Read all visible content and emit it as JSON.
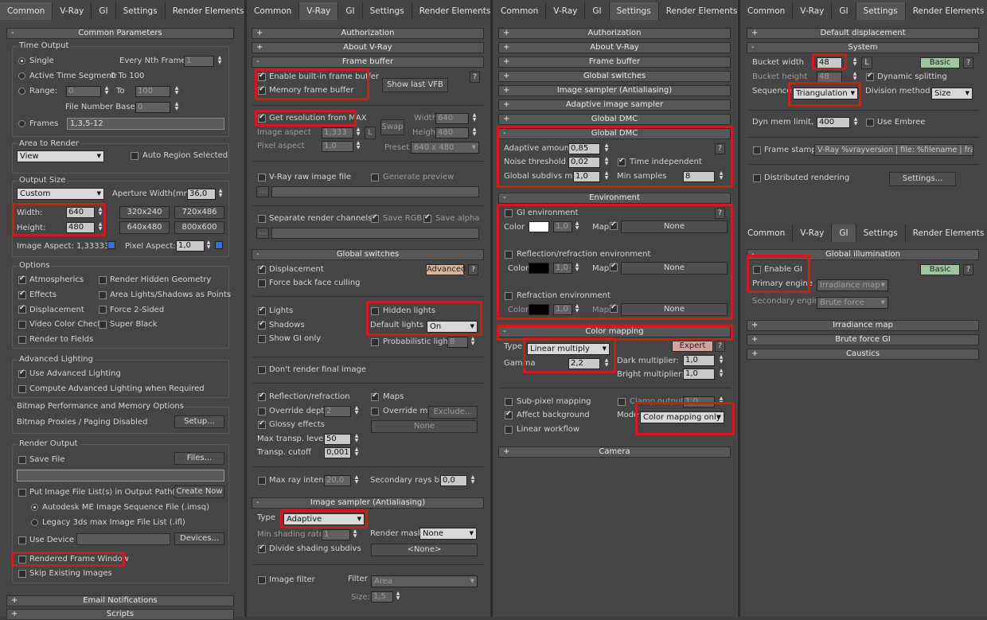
{
  "tabs": [
    "Common",
    "V-Ray",
    "GI",
    "Settings",
    "Render Elements"
  ],
  "common": {
    "rollout_title": "Common Parameters",
    "time_output": {
      "title": "Time Output",
      "single": "Single",
      "every_nth": "Every Nth Frame:",
      "every_nth_val": "1",
      "active_segment": "Active Time Segment:",
      "active_range": "0 To 100",
      "range": "Range:",
      "range_from": "0",
      "to": "To",
      "range_to": "100",
      "file_number_base": "File Number Base:",
      "fnb_val": "0",
      "frames": "Frames",
      "frames_val": "1,3,5-12"
    },
    "area": {
      "title": "Area to Render",
      "value": "View",
      "auto_region": "Auto Region Selected"
    },
    "output_size": {
      "title": "Output Size",
      "preset": "Custom",
      "aperture": "Aperture Width(mm):",
      "aperture_val": "36,0",
      "width": "Width:",
      "width_val": "640",
      "height": "Height:",
      "height_val": "480",
      "presets": [
        "320x240",
        "720x486",
        "640x480",
        "800x600"
      ],
      "image_aspect": "Image Aspect: 1,33333",
      "pixel_aspect": "Pixel Aspect:",
      "pixel_aspect_val": "1,0"
    },
    "options": {
      "title": "Options",
      "atmospherics": "Atmospherics",
      "render_hidden": "Render Hidden Geometry",
      "effects": "Effects",
      "area_lights": "Area Lights/Shadows as Points",
      "displacement": "Displacement",
      "force_2sided": "Force 2-Sided",
      "video_color": "Video Color Check",
      "super_black": "Super Black",
      "render_fields": "Render to Fields"
    },
    "adv_lighting": {
      "title": "Advanced Lighting",
      "use": "Use Advanced Lighting",
      "compute": "Compute Advanced Lighting when Required"
    },
    "bitmap": {
      "title": "Bitmap Performance and Memory Options",
      "proxies": "Bitmap Proxies / Paging Disabled",
      "setup": "Setup..."
    },
    "render_output": {
      "title": "Render Output",
      "save_file": "Save File",
      "files": "Files...",
      "put_image": "Put Image File List(s) in Output Path(s)",
      "create_now": "Create Now",
      "autodesk": "Autodesk ME Image Sequence File (.imsq)",
      "legacy": "Legacy 3ds max Image File List (.ifl)",
      "use_device": "Use Device",
      "devices": "Devices...",
      "rendered_frame": "Rendered Frame Window",
      "skip_existing": "Skip Existing Images"
    },
    "email": "Email Notifications",
    "scripts": "Scripts"
  },
  "vray": {
    "authorization": "Authorization",
    "about": "About V-Ray",
    "frame_buffer": "Frame buffer",
    "enable_vfb": "Enable built-in frame buffer",
    "memory_fb": "Memory frame buffer",
    "show_last_vfb": "Show last VFB",
    "get_res": "Get resolution from MAX",
    "width": "Width",
    "width_val": "640",
    "height": "Height",
    "height_val": "480",
    "swap": "Swap",
    "image_aspect": "Image aspect",
    "image_aspect_val": "1,333",
    "L": "L",
    "pixel_aspect": "Pixel aspect",
    "pixel_aspect_val": "1,0",
    "preset": "Preset",
    "preset_val": "640 x 480",
    "raw_image": "V-Ray raw image file",
    "gen_preview": "Generate preview",
    "separate": "Separate render channels",
    "save_rgb": "Save RGB",
    "save_alpha": "Save alpha",
    "ellipsis": "...",
    "global_switches": "Global switches",
    "displacement": "Displacement",
    "advanced": "Advanced",
    "force_back": "Force back face culling",
    "lights": "Lights",
    "hidden_lights": "Hidden lights",
    "shadows": "Shadows",
    "default_lights": "Default lights",
    "default_lights_val": "On",
    "show_gi_only": "Show GI only",
    "probabilistic": "Probabilistic lights",
    "probabilistic_val": "8",
    "dont_render": "Don't render final image",
    "reflection": "Reflection/refraction",
    "maps": "Maps",
    "override_depth": "Override depth",
    "override_depth_val": "2",
    "override_mtl": "Override mtl",
    "exclude": "Exclude...",
    "glossy": "Glossy effects",
    "none": "None",
    "max_transp": "Max transp. levels",
    "max_transp_val": "50",
    "transp_cutoff": "Transp. cutoff",
    "transp_cutoff_val": "0,001",
    "max_ray": "Max ray intens",
    "max_ray_val": "20,0",
    "secondary_bias": "Secondary rays bias",
    "secondary_bias_val": "0,0",
    "image_sampler": "Image sampler (Antialiasing)",
    "type": "Type",
    "type_val": "Adaptive",
    "min_shading": "Min shading rate",
    "min_shading_val": "1",
    "render_mask": "Render mask",
    "render_mask_val": "None",
    "divide_shading": "Divide shading subdivs",
    "none_btn": "<None>",
    "image_filter": "Image filter",
    "filter": "Filter",
    "filter_val": "Area",
    "size": "Size:",
    "size_val": "1,5",
    "question": "?"
  },
  "gi_col": {
    "authorization": "Authorization",
    "about": "About V-Ray",
    "frame_buffer": "Frame buffer",
    "global_switches": "Global switches",
    "image_sampler": "Image sampler (Antialiasing)",
    "adaptive_sampler": "Adaptive image sampler",
    "global_dmc_collapsed": "Global DMC",
    "global_dmc": "Global DMC",
    "adaptive_amount": "Adaptive amount",
    "adaptive_amount_val": "0,85",
    "noise_threshold": "Noise threshold",
    "noise_threshold_val": "0,02",
    "time_independent": "Time independent",
    "global_subdivs": "Global subdivs mult.",
    "global_subdivs_val": "1,0",
    "min_samples": "Min samples",
    "min_samples_val": "8",
    "environment": "Environment",
    "gi_env": "GI environment",
    "refl_env": "Reflection/refraction environment",
    "refr_env": "Refraction environment",
    "color": "Color",
    "mult_val": "1,0",
    "map": "Map",
    "none": "None",
    "color_mapping": "Color mapping",
    "type": "Type",
    "type_val": "Linear multiply",
    "expert": "Expert",
    "dark_mult": "Dark multiplier:",
    "dark_mult_val": "1,0",
    "gamma": "Gamma",
    "gamma_val": "2,2",
    "bright_mult": "Bright multiplier:",
    "bright_mult_val": "1,0",
    "subpixel": "Sub-pixel mapping",
    "clamp_output": "Clamp output",
    "clamp_val": "1,0",
    "affect_bg": "Affect background",
    "mode": "Mode",
    "mode_val": "Color mapping only (",
    "linear_workflow": "Linear workflow",
    "camera": "Camera",
    "question": "?"
  },
  "settings_col": {
    "default_displacement": "Default displacement",
    "system": "System",
    "bucket_width": "Bucket width",
    "bucket_width_val": "48",
    "L": "L",
    "basic": "Basic",
    "bucket_height": "Bucket height",
    "bucket_height_val": "48",
    "dynamic_splitting": "Dynamic splitting",
    "sequence": "Sequence",
    "sequence_val": "Triangulation",
    "division_method": "Division method",
    "division_val": "Size",
    "dyn_mem": "Dyn mem limit, mb",
    "dyn_mem_val": "400",
    "use_embree": "Use Embree",
    "frame_stamp": "Frame stamp",
    "frame_stamp_val": "V-Ray %vrayversion | file: %filename | frame",
    "distributed": "Distributed rendering",
    "settings_btn": "Settings...",
    "question": "?"
  },
  "gi_panel": {
    "global_illumination": "Global illumination",
    "enable_gi": "Enable GI",
    "basic": "Basic",
    "primary": "Primary engine",
    "primary_val": "Irradiance map",
    "secondary": "Secondary engine",
    "secondary_val": "Brute force",
    "irradiance_map": "Irradiance map",
    "brute_force_gi": "Brute force GI",
    "caustics": "Caustics",
    "question": "?"
  },
  "colors": {
    "highlight": "#d11a1a",
    "basic_green": "#9fc79f",
    "advanced": "#d8b59a",
    "expert": "#d9a0a0"
  }
}
